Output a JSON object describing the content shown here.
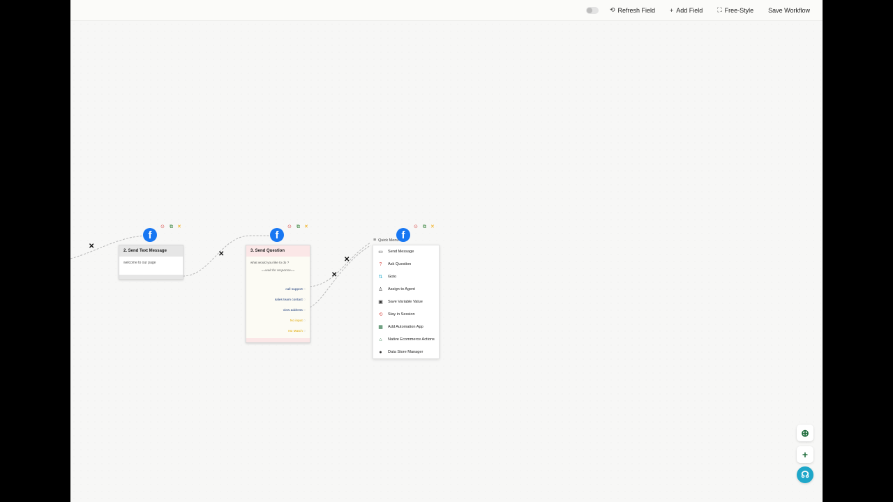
{
  "toolbar": {
    "refresh_label": "Refresh Field",
    "add_label": "Add Field",
    "freestyle_label": "Free-Style",
    "save_label": "Save Workflow"
  },
  "nodes": {
    "send_text": {
      "title": "2. Send Text Message",
      "body": "welcome to our page"
    },
    "send_question": {
      "title": "3. Send Question",
      "question": "what would you like to do ?",
      "wait": "==wait for response==",
      "options": [
        "call support",
        "sales team contact",
        "view address"
      ],
      "no_input": "No input",
      "no_match": "No Match"
    }
  },
  "quick_menu": {
    "label": "Quick Menu",
    "items": [
      "Send Message",
      "Ask Question",
      "Goto",
      "Assign to Agent",
      "Save Variable Value",
      "Stay in Session",
      "Add Automation App",
      "Native Ecommerce Actions",
      "Data Store Manager"
    ]
  },
  "colors": {
    "facebook": "#1877f2",
    "accent_green": "#1d6b3a",
    "support_teal": "#1fa7c9",
    "question_header": "#fbe7e7",
    "text_header": "#e6e6e6"
  }
}
